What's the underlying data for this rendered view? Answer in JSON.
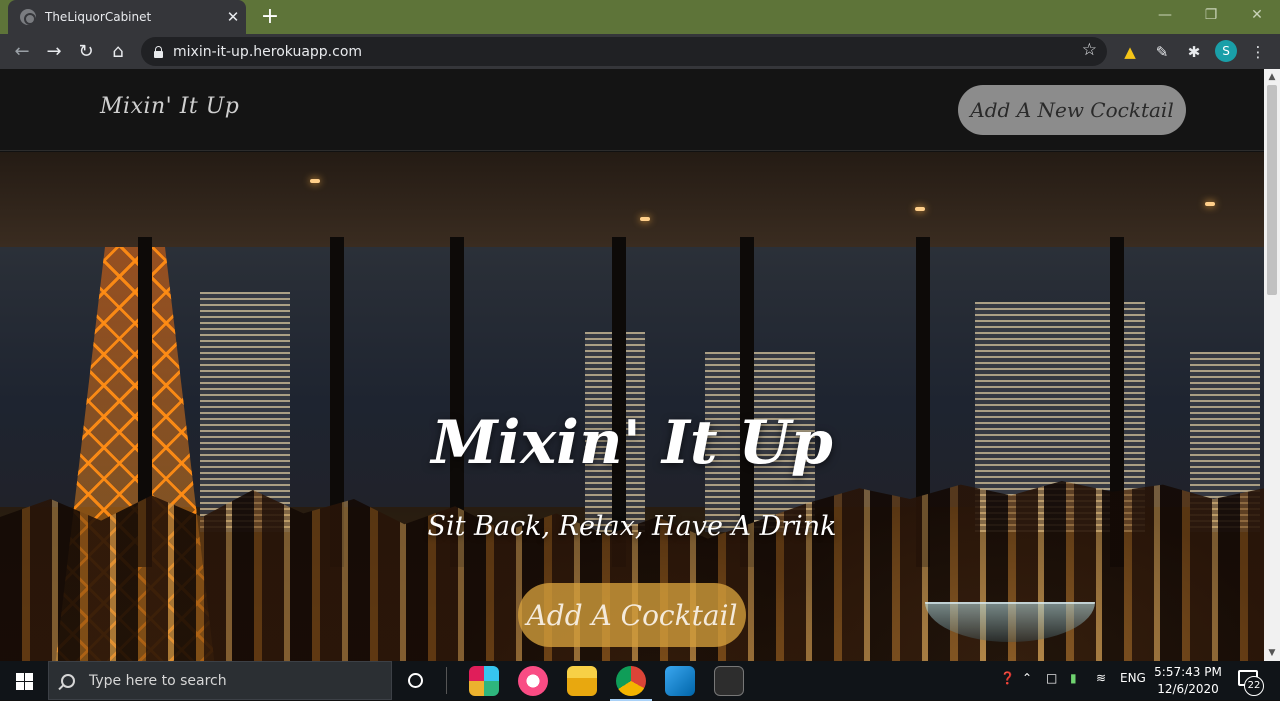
{
  "browser": {
    "tab_title": "TheLiquorCabinet",
    "tab_close": "✕",
    "new_tab": "+",
    "url": "mixin-it-up.herokuapp.com",
    "profile_initial": "S"
  },
  "site": {
    "brand": "Mixin' It Up",
    "header_button": "Add A New Cocktail",
    "hero_title": "Mixin' It Up",
    "hero_subtitle": "Sit Back, Relax, Have A Drink",
    "hero_button": "Add A Cocktail"
  },
  "taskbar": {
    "search_placeholder": "Type here to search",
    "language": "ENG",
    "time": "5:57:43 PM",
    "date": "12/6/2020",
    "notification_count": "22"
  },
  "icons": {
    "back": "back-arrow-icon",
    "forward": "forward-arrow-icon",
    "reload": "reload-icon",
    "home": "home-icon",
    "bookmark": "star-icon",
    "extensions": "puzzle-icon"
  },
  "colors": {
    "tabbar": "#5e7439",
    "header_button": "#8c8c8c",
    "hero_button": "#d6a03c"
  }
}
